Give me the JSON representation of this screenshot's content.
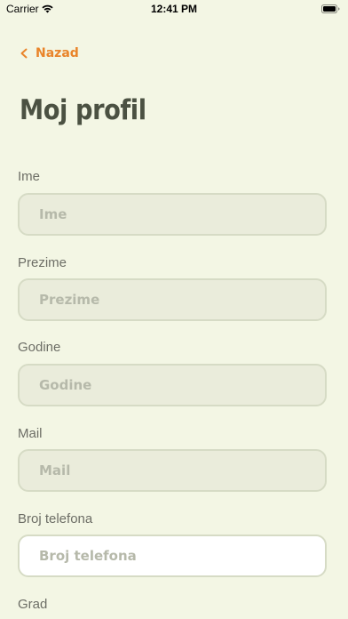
{
  "status_bar": {
    "carrier": "Carrier",
    "time": "12:41 PM",
    "wifi_icon": "wifi-icon",
    "battery_icon": "battery-icon"
  },
  "nav": {
    "back_label": "Nazad",
    "back_icon": "chevron-left-icon"
  },
  "page": {
    "title": "Moj profil"
  },
  "form": {
    "fields": [
      {
        "label": "Ime",
        "placeholder": "Ime",
        "value": ""
      },
      {
        "label": "Prezime",
        "placeholder": "Prezime",
        "value": ""
      },
      {
        "label": "Godine",
        "placeholder": "Godine",
        "value": ""
      },
      {
        "label": "Mail",
        "placeholder": "Mail",
        "value": ""
      },
      {
        "label": "Broj telefona",
        "placeholder": "Broj telefona",
        "value": "",
        "focused": true
      },
      {
        "label": "Grad"
      }
    ]
  },
  "colors": {
    "background": "#f3f6e4",
    "accent": "#e9842a",
    "title": "#4b5142",
    "input_bg": "#eaecdb",
    "input_border": "#d6dbc5",
    "placeholder": "#b6b9aa"
  }
}
